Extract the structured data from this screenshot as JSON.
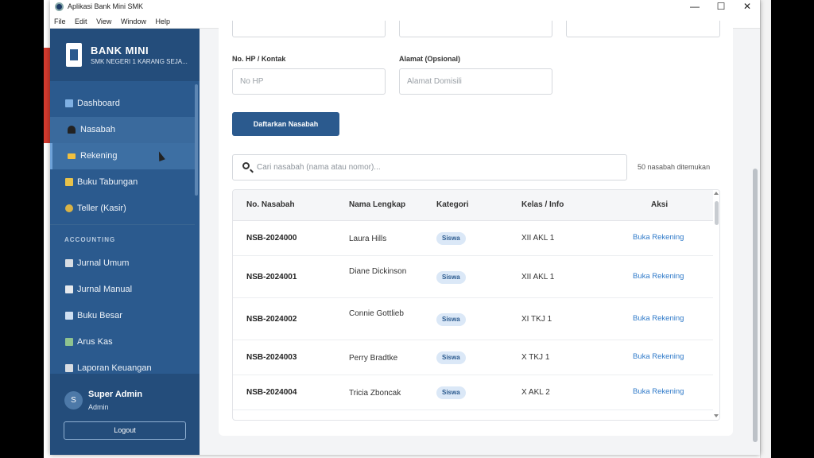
{
  "window": {
    "title": "Aplikasi Bank Mini SMK"
  },
  "menu": [
    "File",
    "Edit",
    "View",
    "Window",
    "Help"
  ],
  "brand": {
    "name": "BANK MINI",
    "subtitle": "SMK NEGERI 1 KARANG SEJA..."
  },
  "nav": {
    "dashboard": "Dashboard",
    "nasabah": "Nasabah",
    "rekening": "Rekening",
    "buku_tabungan": "Buku Tabungan",
    "teller": "Teller (Kasir)",
    "section_accounting": "ACCOUNTING",
    "jurnal_umum": "Jurnal Umum",
    "jurnal_manual": "Jurnal Manual",
    "buku_besar": "Buku Besar",
    "arus_kas": "Arus Kas",
    "laporan_keuangan": "Laporan Keuangan"
  },
  "user": {
    "initial": "S",
    "name": "Super Admin",
    "role": "Admin",
    "logout_label": "Logout"
  },
  "form": {
    "hp_label": "No. HP / Kontak",
    "hp_placeholder": "No HP",
    "alamat_label": "Alamat (Opsional)",
    "alamat_placeholder": "Alamat Domisili",
    "submit_label": "Daftarkan Nasabah"
  },
  "search": {
    "placeholder": "Cari nasabah (nama atau nomor)...",
    "count_text": "50 nasabah ditemukan"
  },
  "table": {
    "headers": [
      "No. Nasabah",
      "Nama Lengkap",
      "Kategori",
      "Kelas / Info",
      "Aksi"
    ],
    "rows": [
      {
        "no": "NSB-2024000",
        "name": "Laura Hills",
        "category": "Siswa",
        "kelas": "XII AKL 1",
        "action": "Buka Rekening"
      },
      {
        "no": "NSB-2024001",
        "name": "Diane Dickinson",
        "category": "Siswa",
        "kelas": "XII AKL 1",
        "action": "Buka Rekening"
      },
      {
        "no": "NSB-2024002",
        "name": "Connie Gottlieb",
        "category": "Siswa",
        "kelas": "XI TKJ 1",
        "action": "Buka Rekening"
      },
      {
        "no": "NSB-2024003",
        "name": "Perry Bradtke",
        "category": "Siswa",
        "kelas": "X TKJ 1",
        "action": "Buka Rekening"
      },
      {
        "no": "NSB-2024004",
        "name": "Tricia Zboncak",
        "category": "Siswa",
        "kelas": "X AKL 2",
        "action": "Buka Rekening"
      }
    ]
  },
  "colors": {
    "sidebar": "#2b5a8e",
    "accent": "#2b5a8e",
    "link": "#2f7ac9",
    "badge_bg": "#dbe8f7"
  }
}
